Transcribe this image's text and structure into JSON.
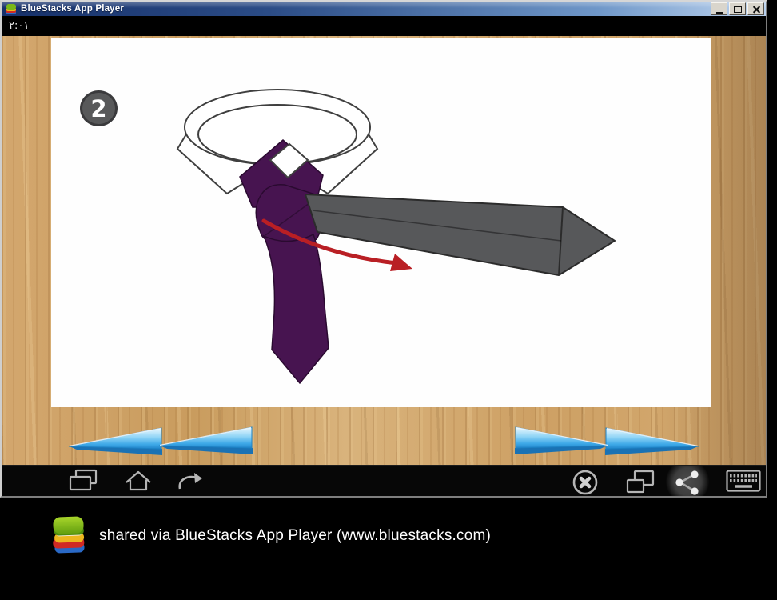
{
  "theme": {
    "titlebar-left": "#16306a",
    "titlebar-right": "#b7cfec",
    "statusbar-bg": "#000000",
    "wood-base": "#cfa166",
    "card-bg": "#fefefe",
    "tie-purple": "#471450",
    "tie-purple-dark": "#2a0a30",
    "blade-gray": "#57585a",
    "blade-outline": "#2b2b2b",
    "arrow-red": "#b91f24",
    "step-badge-bg": "#58595a",
    "nav-arrow-bevel": "#1a72b4",
    "navbar-bg": "#070707",
    "navbar-icon": "#b5b5b5",
    "desktop-bg": "#000000"
  },
  "window": {
    "title": "BlueStacks App Player",
    "controls": [
      "minimize",
      "maximize",
      "close"
    ]
  },
  "android": {
    "status_time": "٢:٠١",
    "nav_icons": [
      "recent-apps",
      "home",
      "back",
      "close-app",
      "switch-window",
      "share",
      "keyboard"
    ]
  },
  "app": {
    "step_number": "2",
    "nav": {
      "previous": "previous-step-arrows",
      "next": "next-step-arrows"
    }
  },
  "footer": {
    "share_text": "shared via BlueStacks App Player (www.bluestacks.com)"
  }
}
